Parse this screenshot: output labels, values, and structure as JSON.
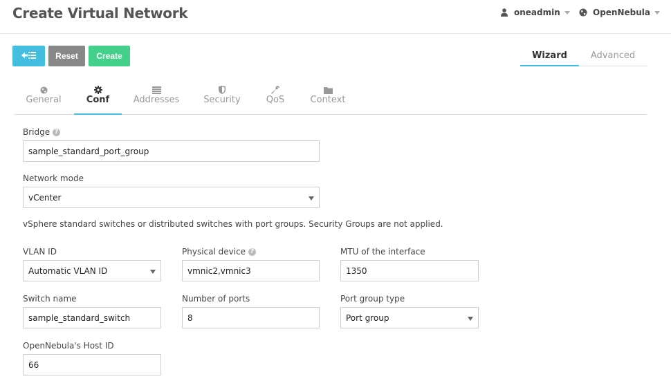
{
  "header": {
    "title": "Create Virtual Network",
    "user": "oneadmin",
    "zone": "OpenNebula"
  },
  "toolbar": {
    "reset_label": "Reset",
    "create_label": "Create"
  },
  "mode_tabs": {
    "wizard": "Wizard",
    "advanced": "Advanced",
    "active": "Wizard"
  },
  "section_tabs": [
    {
      "label": "General",
      "icon": "globe-icon"
    },
    {
      "label": "Conf",
      "icon": "gear-icon"
    },
    {
      "label": "Addresses",
      "icon": "list-icon"
    },
    {
      "label": "Security",
      "icon": "shield-icon"
    },
    {
      "label": "QoS",
      "icon": "wrench-icon"
    },
    {
      "label": "Context",
      "icon": "folder-icon"
    }
  ],
  "active_section": "Conf",
  "form": {
    "bridge": {
      "label": "Bridge",
      "value": "sample_standard_port_group"
    },
    "network_mode": {
      "label": "Network mode",
      "value": "vCenter"
    },
    "mode_info": "vSphere standard switches or distributed switches with port groups. Security Groups are not applied.",
    "vlan_id": {
      "label": "VLAN ID",
      "value": "Automatic VLAN ID"
    },
    "physical_device": {
      "label": "Physical device",
      "value": "vmnic2,vmnic3"
    },
    "mtu": {
      "label": "MTU of the interface",
      "value": "1350"
    },
    "switch_name": {
      "label": "Switch name",
      "value": "sample_standard_switch"
    },
    "num_ports": {
      "label": "Number of ports",
      "value": "8"
    },
    "port_group_type": {
      "label": "Port group type",
      "value": "Port group"
    },
    "host_id": {
      "label": "OpenNebula's Host ID",
      "value": "66"
    }
  },
  "colors": {
    "accent": "#44bede",
    "create": "#43d08a",
    "reset": "#888888"
  }
}
